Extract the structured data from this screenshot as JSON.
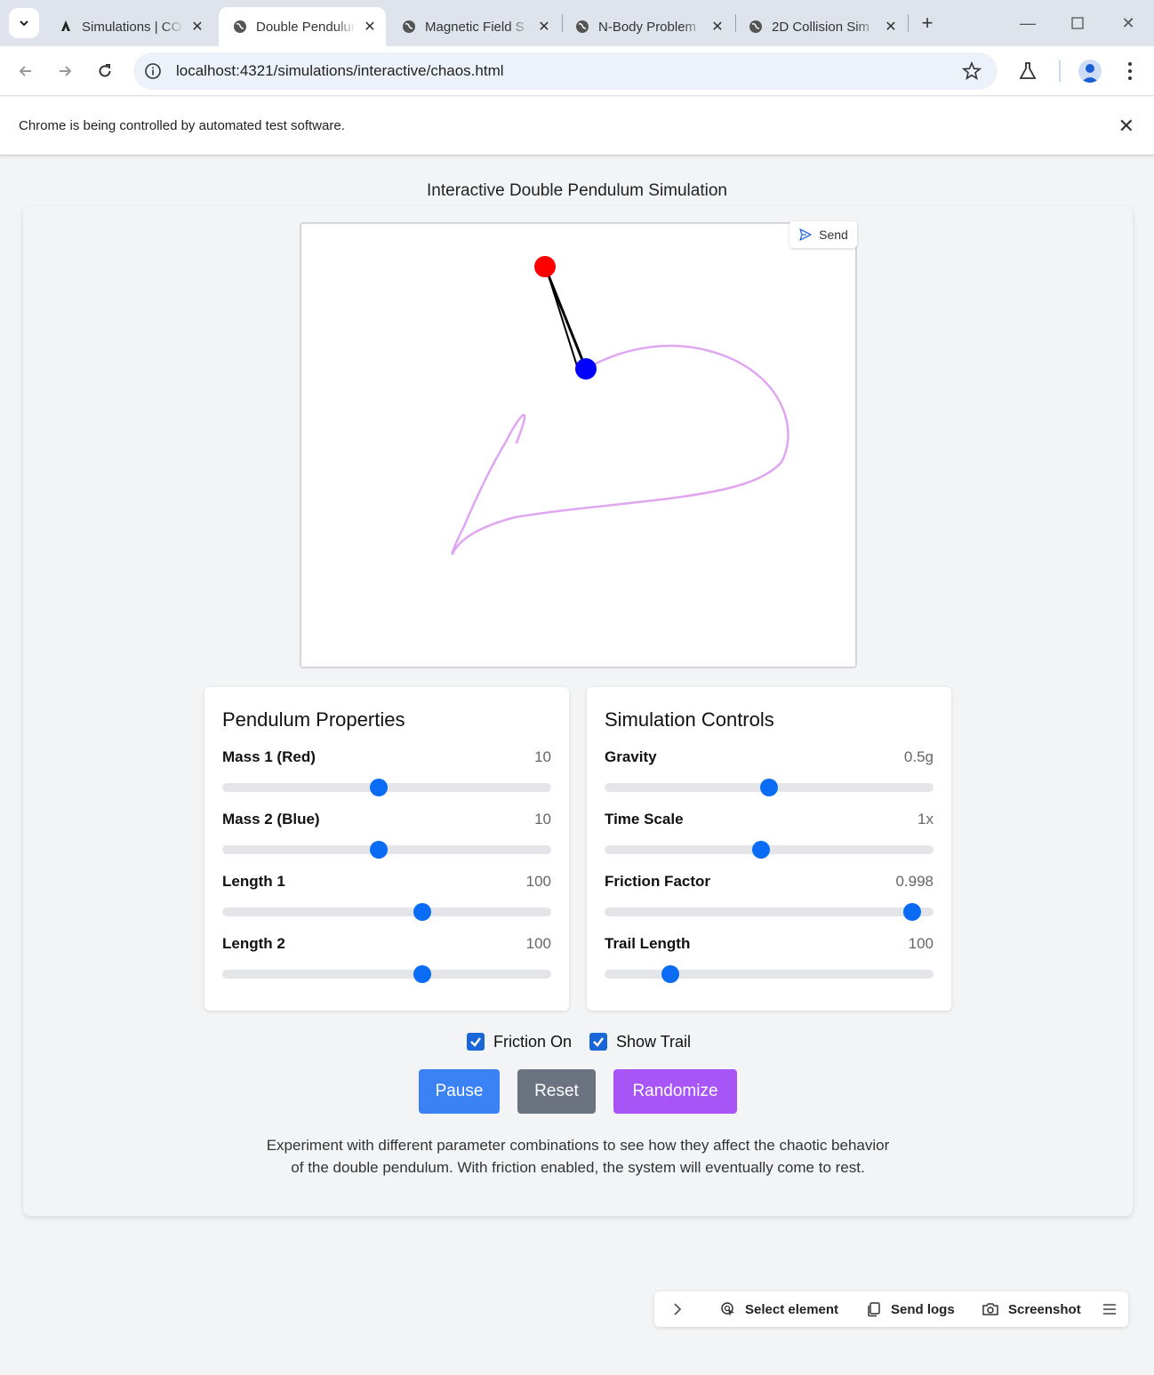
{
  "browser": {
    "tabs": [
      {
        "title": "Simulations | CO",
        "active": false
      },
      {
        "title": "Double Pendulum",
        "active": true
      },
      {
        "title": "Magnetic Field S",
        "active": false
      },
      {
        "title": "N-Body Problem",
        "active": false
      },
      {
        "title": "2D Collision Sim",
        "active": false
      }
    ],
    "url": "localhost:4321/simulations/interactive/chaos.html",
    "infobar": "Chrome is being controlled by automated test software."
  },
  "page": {
    "title": "Interactive Double Pendulum Simulation",
    "send_label": "Send"
  },
  "pendulum_props": {
    "heading": "Pendulum Properties",
    "controls": [
      {
        "label": "Mass 1 (Red)",
        "value": "10",
        "fraction": 0.475
      },
      {
        "label": "Mass 2 (Blue)",
        "value": "10",
        "fraction": 0.475
      },
      {
        "label": "Length 1",
        "value": "100",
        "fraction": 0.609
      },
      {
        "label": "Length 2",
        "value": "100",
        "fraction": 0.609
      }
    ]
  },
  "sim_controls": {
    "heading": "Simulation Controls",
    "controls": [
      {
        "label": "Gravity",
        "value": "0.5g",
        "fraction": 0.5
      },
      {
        "label": "Time Scale",
        "value": "1x",
        "fraction": 0.475
      },
      {
        "label": "Friction Factor",
        "value": "0.998",
        "fraction": 0.935
      },
      {
        "label": "Trail Length",
        "value": "100",
        "fraction": 0.2
      }
    ]
  },
  "options": {
    "friction_label": "Friction On",
    "friction_checked": true,
    "trail_label": "Show Trail",
    "trail_checked": true
  },
  "buttons": {
    "pause": "Pause",
    "reset": "Reset",
    "randomize": "Randomize"
  },
  "colors": {
    "pause": "#3b82f6",
    "reset": "#6b7280",
    "randomize": "#a855f7",
    "mass1": "#ff0000",
    "mass2": "#0000ff",
    "trail": "#e0a6f2"
  },
  "description": "Experiment with different parameter combinations to see how they affect the chaotic behavior of the double pendulum. With friction enabled, the system will eventually come to rest.",
  "devtools": {
    "select_element": "Select element",
    "send_logs": "Send logs",
    "screenshot": "Screenshot"
  }
}
